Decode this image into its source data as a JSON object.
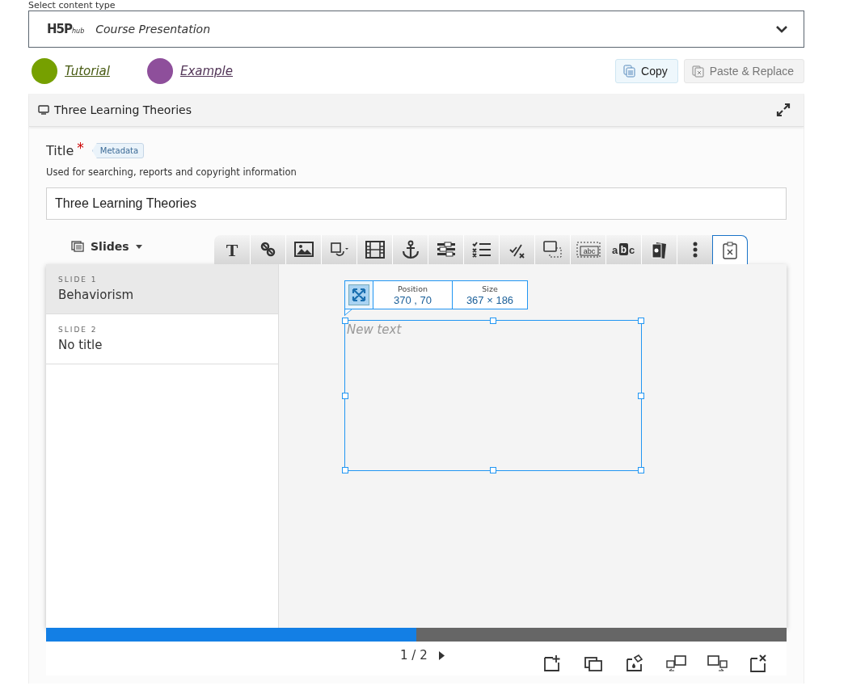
{
  "content_type": {
    "label": "Select content type",
    "logo_suffix": "hub",
    "logo_text": "H5P",
    "value": "Course Presentation"
  },
  "links": [
    {
      "label": "Tutorial",
      "color": "#76a000"
    },
    {
      "label": "Example",
      "color": "#8e4f9b"
    }
  ],
  "actions": [
    {
      "label": "Copy",
      "disabled": false
    },
    {
      "label": "Paste & Replace",
      "disabled": true
    }
  ],
  "panel": {
    "title": "Three Learning Theories"
  },
  "title_field": {
    "label": "Title",
    "required": true,
    "required_mark": "*",
    "metadata": "Metadata",
    "description": "Used for searching, reports and copyright information",
    "value": "Three Learning Theories"
  },
  "slides_menu": {
    "label": "Slides"
  },
  "tools": [
    {
      "selected": false,
      "glyphs": [
        "T"
      ]
    },
    {
      "selected": false
    },
    {
      "selected": false
    },
    {
      "selected": false
    },
    {
      "selected": false
    },
    {
      "selected": false
    },
    {
      "selected": false
    },
    {
      "selected": false
    },
    {
      "selected": false
    },
    {
      "selected": false
    },
    {
      "selected": false,
      "glyphs": [
        "abc"
      ]
    },
    {
      "selected": false,
      "glyphs": [
        "a",
        "b",
        "c"
      ]
    },
    {
      "selected": false
    },
    {
      "selected": false
    },
    {
      "selected": true
    }
  ],
  "slides": [
    {
      "label": "SLIDE 1",
      "title": "Behaviorism",
      "selected": true
    },
    {
      "label": "SLIDE 2",
      "title": "No title",
      "selected": false
    }
  ],
  "element": {
    "position_label": "Position",
    "position": "370 , 70",
    "size_label": "Size",
    "size": "367 × 186",
    "placeholder": "New text"
  },
  "progress": {
    "level": 0.5
  },
  "pager": {
    "text": "1 / 2"
  }
}
